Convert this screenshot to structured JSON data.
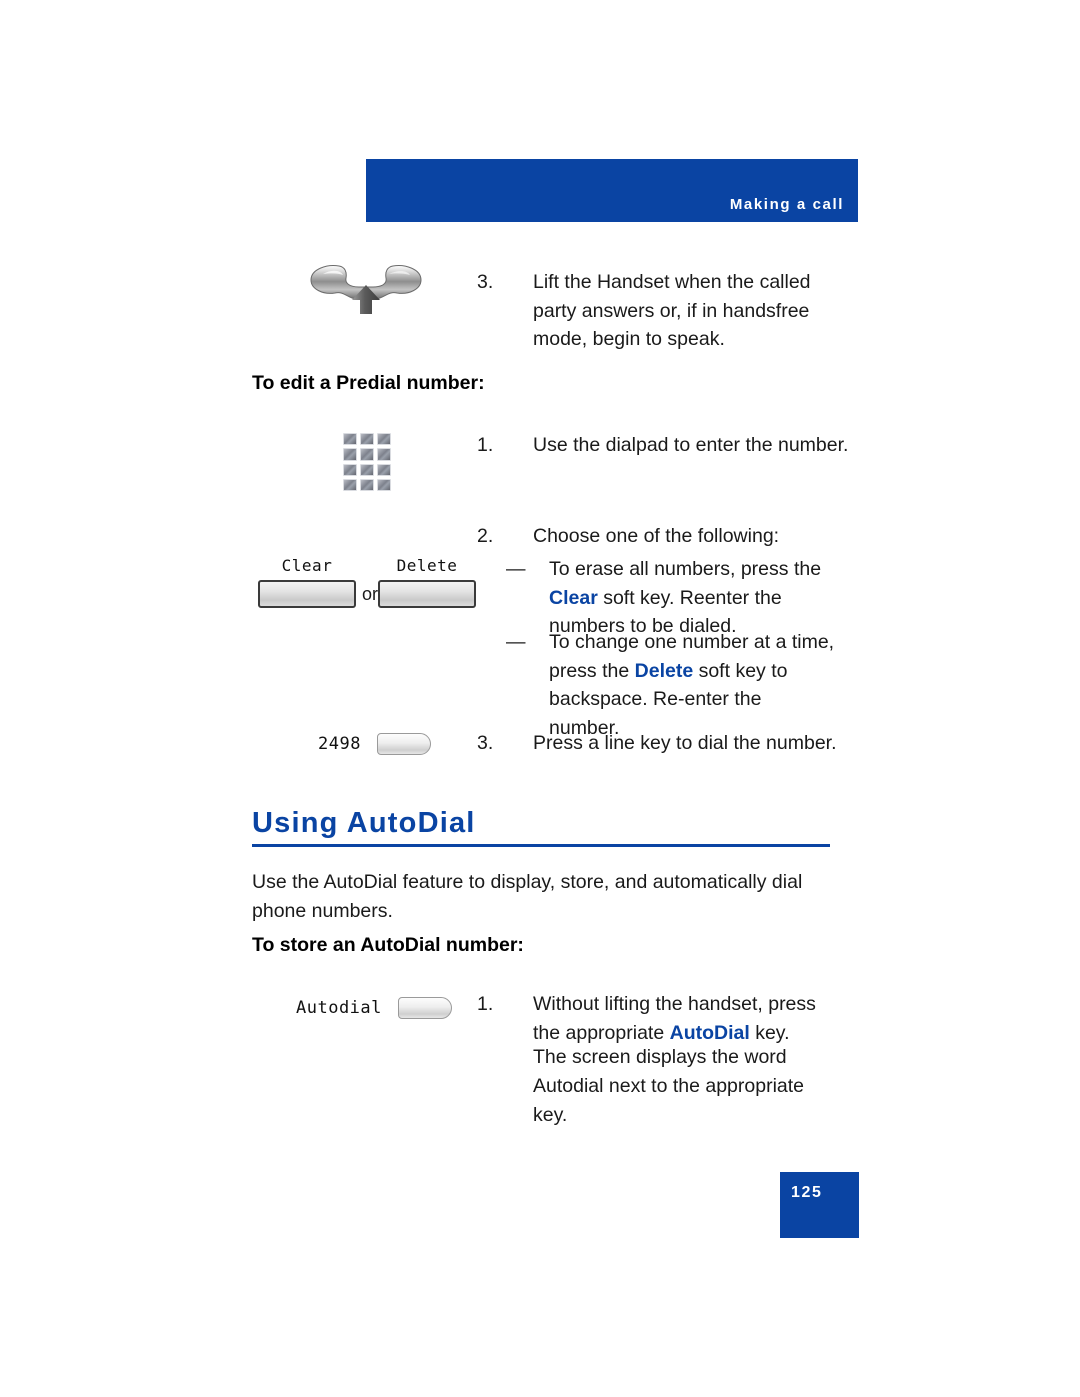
{
  "header": {
    "title": "Making a call"
  },
  "colors": {
    "brand_blue": "#0A44A3",
    "text": "#1a1a1a"
  },
  "steps_top": [
    {
      "num": "3.",
      "text": "Lift the Handset when the called party answers or, if in handsfree mode, begin to speak."
    }
  ],
  "subhead_predial": "To edit a Predial number:",
  "predial_steps": [
    {
      "num": "1.",
      "text": "Use the dialpad to enter the number."
    },
    {
      "num": "2.",
      "text": "Choose one of the following:"
    },
    {
      "num": "3.",
      "text": "Press a line key to dial the number."
    }
  ],
  "predial_bullets": [
    {
      "dash": "—",
      "part1": "To erase all numbers, press the ",
      "emphasis": "Clear",
      "part2": " soft key. Reenter the numbers to be dialed."
    },
    {
      "dash": "—",
      "part1": "To change one number at a time, press the ",
      "emphasis": "Delete",
      "part2": " soft key to backspace. Re-enter the number."
    }
  ],
  "softkeys": {
    "clear_label": "Clear",
    "delete_label": "Delete",
    "or_label": "or"
  },
  "line_key": {
    "label": "2498"
  },
  "section": {
    "title": "Using AutoDial",
    "paragraph": "Use the AutoDial feature to display, store, and automatically dial phone numbers.",
    "subhead": "To store an AutoDial number:"
  },
  "autodial_key": {
    "label": "Autodial"
  },
  "autodial_steps": [
    {
      "num": "1.",
      "part1": "Without lifting the handset, press the appropriate ",
      "emphasis": "AutoDial",
      "part2": " key."
    }
  ],
  "autodial_note": "The screen displays the word Autodial next to the appropriate key.",
  "page_number": "125",
  "icons": {
    "handset": "handset-lift-icon",
    "dialpad": "dialpad-icon"
  }
}
